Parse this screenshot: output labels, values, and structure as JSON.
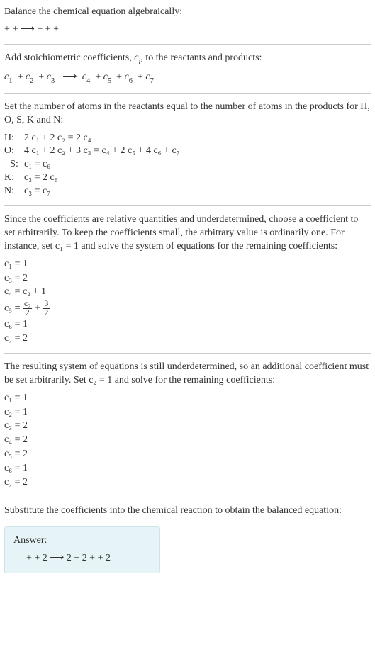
{
  "title": "Balance the chemical equation algebraically:",
  "reaction_unbalanced": " +  +  ⟶  +  +  + ",
  "coeff_intro": "Add stoichiometric coefficients, cᵢ, to the reactants and products:",
  "coeff_reaction_parts": {
    "c1": "c",
    "n1": "1",
    "c2": "c",
    "n2": "2",
    "c3": "c",
    "n3": "3",
    "c4": "c",
    "n4": "4",
    "c5": "c",
    "n5": "5",
    "c6": "c",
    "n6": "6",
    "c7": "c",
    "n7": "7",
    "plus": " + ",
    "arrow": "⟶"
  },
  "atoms_intro": "Set the number of atoms in the reactants equal to the number of atoms in the products for H, O, S, K and N:",
  "atoms": [
    {
      "label": "H:",
      "lhs": "2 c₁ + 2 c₂",
      "rhs": "2 c₄"
    },
    {
      "label": "O:",
      "lhs": "4 c₁ + 2 c₂ + 3 c₃",
      "rhs": "c₄ + 2 c₅ + 4 c₆ + c₇"
    },
    {
      "label": "S:",
      "lhs": "c₁",
      "rhs": "c₆"
    },
    {
      "label": "K:",
      "lhs": "c₃",
      "rhs": "2 c₆"
    },
    {
      "label": "N:",
      "lhs": "c₃",
      "rhs": "c₇"
    }
  ],
  "underdet1": "Since the coefficients are relative quantities and underdetermined, choose a coefficient to set arbitrarily. To keep the coefficients small, the arbitrary value is ordinarily one. For instance, set c₁ = 1 and solve the system of equations for the remaining coefficients:",
  "sol1_lines": {
    "l1": "c₁ = 1",
    "l2": "c₃ = 2",
    "l3": "c₄ = c₂ + 1",
    "l4_prefix": "c₅ = ",
    "l4_frac1_num": "c₂",
    "l4_frac1_den": "2",
    "l4_plus": " + ",
    "l4_frac2_num": "3",
    "l4_frac2_den": "2",
    "l5": "c₆ = 1",
    "l6": "c₇ = 2"
  },
  "underdet2": "The resulting system of equations is still underdetermined, so an additional coefficient must be set arbitrarily. Set c₂ = 1 and solve for the remaining coefficients:",
  "sol2_lines": [
    "c₁ = 1",
    "c₂ = 1",
    "c₃ = 2",
    "c₄ = 2",
    "c₅ = 2",
    "c₆ = 1",
    "c₇ = 2"
  ],
  "subst_text": "Substitute the coefficients into the chemical reaction to obtain the balanced equation:",
  "answer_label": "Answer:",
  "answer_reaction": " +  + 2  ⟶ 2  + 2  +  + 2 "
}
